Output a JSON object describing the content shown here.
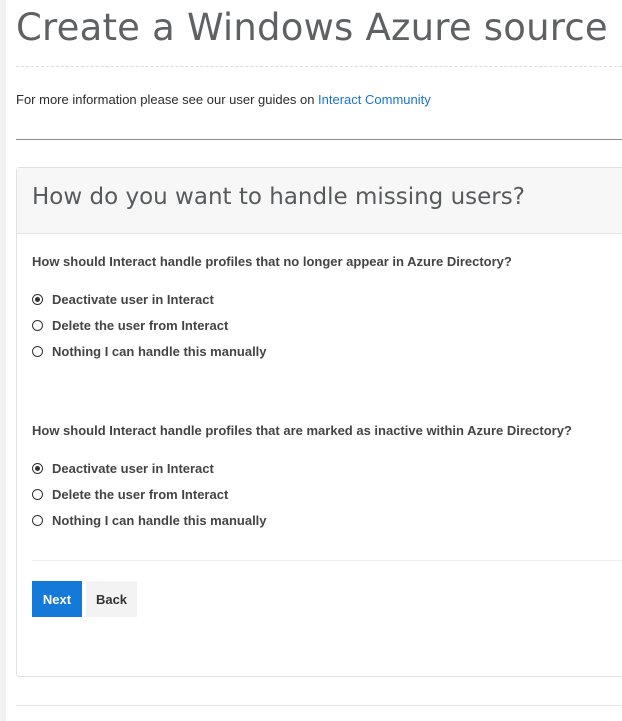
{
  "page": {
    "title": "Create a Windows Azure source",
    "info_prefix": "For more information please see our user guides on ",
    "info_link": "Interact Community"
  },
  "panel": {
    "title": "How do you want to handle missing users?",
    "q1": {
      "question": "How should Interact handle profiles that no longer appear in Azure Directory?",
      "selected": 0,
      "options": [
        "Deactivate user in Interact",
        "Delete the user from Interact",
        "Nothing I can handle this manually"
      ]
    },
    "q2": {
      "question": "How should Interact handle profiles that are marked as inactive within Azure Directory?",
      "selected": 0,
      "options": [
        "Deactivate user in Interact",
        "Delete the user from Interact",
        "Nothing I can handle this manually"
      ]
    }
  },
  "buttons": {
    "next": "Next",
    "back": "Back"
  },
  "colors": {
    "accent": "#1479d8",
    "link": "#1a74c8",
    "title": "#5f6163"
  }
}
